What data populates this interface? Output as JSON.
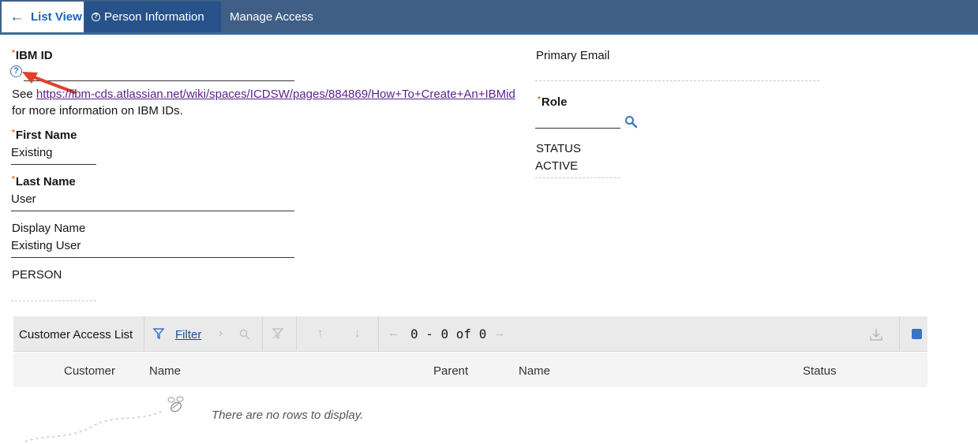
{
  "tabs": {
    "list_view": "List View",
    "person_information": "Person Information",
    "manage_access": "Manage Access"
  },
  "form": {
    "ibm_id": {
      "label": "IBM ID",
      "value": ""
    },
    "note": {
      "prefix": "See ",
      "link": "https://ibm-cds.atlassian.net/wiki/spaces/ICDSW/pages/884869/How+To+Create+An+IBMid",
      "suffix": "for more information on IBM IDs."
    },
    "first_name": {
      "label": "First Name",
      "value": "Existing"
    },
    "last_name": {
      "label": "Last Name",
      "value": "User"
    },
    "display_name": {
      "label": "Display Name",
      "value": "Existing User"
    },
    "person": {
      "label": "PERSON",
      "value": ""
    },
    "primary_email": {
      "label": "Primary Email",
      "value": ""
    },
    "role": {
      "label": "Role",
      "value": ""
    },
    "status": {
      "label": "STATUS",
      "value": "ACTIVE"
    }
  },
  "table": {
    "title": "Customer Access List",
    "filter_label": "Filter",
    "pager": "0 - 0 of 0",
    "columns": [
      "Customer",
      "Name",
      "Parent",
      "Name",
      "Status"
    ],
    "empty_message": "There are no rows to display."
  },
  "colors": {
    "tabbar": "#3f5f86",
    "active_tab": "#27528a",
    "accent": "#3c74c4",
    "required": "#e8621f",
    "annotation_arrow": "#e0402a"
  },
  "icons": [
    "back-arrow-icon",
    "help-icon",
    "search-icon",
    "filter-icon",
    "download-icon",
    "bee-icon"
  ]
}
